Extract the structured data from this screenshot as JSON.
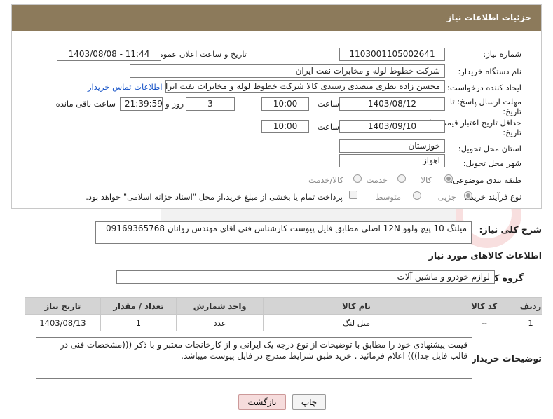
{
  "header": {
    "title": "جزئیات اطلاعات نیاز"
  },
  "form": {
    "need_number_label": "شماره نیاز:",
    "need_number": "1103001105002641",
    "announce_label": "تاریخ و ساعت اعلان عمومی:",
    "announce_value": "1403/08/08 - 11:44",
    "buyer_org_label": "نام دستگاه خریدار:",
    "buyer_org": "شرکت خطوط لوله و مخابرات نفت ایران",
    "requester_label": "ایجاد کننده درخواست:",
    "requester": "محسن زاده نظری متصدی رسیدی کالا شرکت خطوط لوله و مخابرات نفت ایران",
    "contact_link": "اطلاعات تماس خریدار",
    "deadline_label_1": "مهلت ارسال پاسخ: تا",
    "deadline_label_2": "تاریخ:",
    "deadline_date": "1403/08/12",
    "time_label": "ساعت",
    "deadline_time": "10:00",
    "days_value": "3",
    "days_label": "روز و",
    "remaining_time": "21:39:59",
    "remaining_label": "ساعت باقی مانده",
    "validity_label_1": "حداقل تاریخ اعتبار قیمت: تا",
    "validity_label_2": "تاریخ:",
    "validity_date": "1403/09/10",
    "validity_time": "10:00",
    "province_label": "استان محل تحویل:",
    "province": "خوزستان",
    "city_label": "شهر محل تحویل:",
    "city": "اهواز",
    "category_label": "طبقه بندی موضوعی:",
    "category_options": [
      "کالا",
      "خدمت",
      "کالا/خدمت"
    ],
    "process_label": "نوع فرآیند خرید :",
    "process_options": [
      "جزیی",
      "متوسط"
    ],
    "payment_note": "پرداخت تمام یا بخشی از مبلغ خرید،از محل \"اسناد خزانه اسلامی\" خواهد بود."
  },
  "description": {
    "label": "شرح کلی نیاز:",
    "text": "میلنگ 10 پیچ ولوو 12N اصلی مطابق فایل پیوست کارشناس فنی آقای مهندس روانان 09169365768"
  },
  "goods": {
    "section_title": "اطلاعات کالاهای مورد نیاز",
    "group_label": "گروه کالا:",
    "group_value": "لوازم خودرو و ماشین آلات",
    "columns": [
      "ردیف",
      "کد کالا",
      "نام کالا",
      "واحد شمارش",
      "تعداد / مقدار",
      "تاریخ نیاز"
    ],
    "rows": [
      {
        "row": "1",
        "code": "--",
        "name": "میل لنگ",
        "unit": "عدد",
        "qty": "1",
        "date": "1403/08/13"
      }
    ]
  },
  "buyer_notes": {
    "label": "توضیحات خریدار:",
    "text": "قیمت پیشنهادی خود را مطابق با توضیحات از نوع درجه یک ایرانی و از کارخانجات معتبر و با ذکر (((مشخصات فنی در قالب فایل جدا))) اعلام فرمائید . خرید طبق شرایط مندرج در فایل پیوست میباشد."
  },
  "buttons": {
    "print": "چاپ",
    "back": "بازگشت"
  },
  "colors": {
    "header": "#8c7a5b",
    "link": "#1a56c8",
    "table_header": "#d4d4d4",
    "back_button": "#f6dcdc"
  }
}
